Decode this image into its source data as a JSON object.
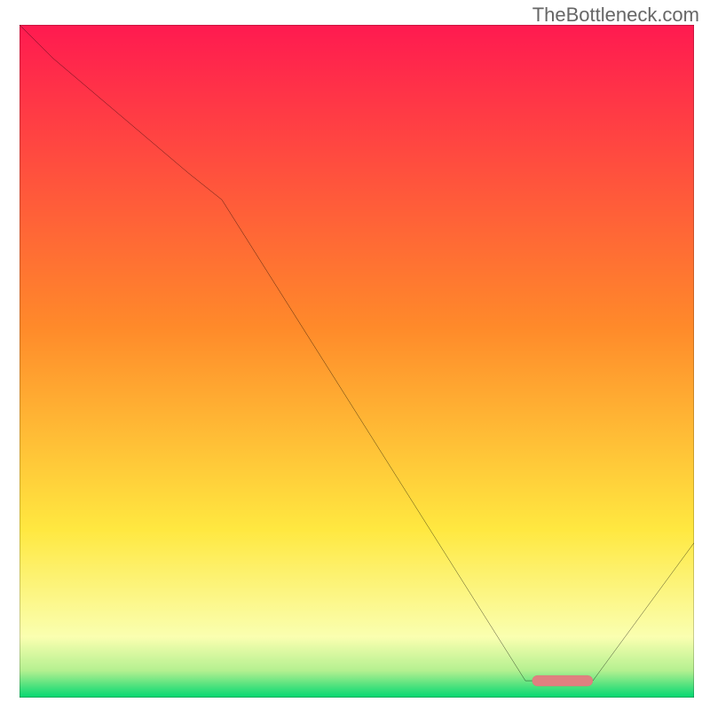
{
  "watermark": "TheBottleneck.com",
  "colors": {
    "line": "#000000",
    "marker_fill": "#e08080",
    "marker_stroke": "#c7605e",
    "border": "#000000",
    "grad_top": "#ff1a50",
    "grad_mid_upper": "#ff8a2a",
    "grad_mid_lower": "#ffe840",
    "grad_pale": "#faffb0",
    "grad_green": "#00d770"
  },
  "chart_data": {
    "type": "line",
    "title": "",
    "xlabel": "",
    "ylabel": "",
    "xlim": [
      0,
      100
    ],
    "ylim": [
      0,
      100
    ],
    "x": [
      0,
      5,
      25,
      30,
      75,
      78,
      85,
      100
    ],
    "values": [
      100,
      95,
      78,
      74,
      2.5,
      2.5,
      2.5,
      23
    ],
    "annotations": [
      {
        "type": "marker-bar",
        "x_start": 76,
        "x_end": 85,
        "y": 2.5
      }
    ],
    "background_bands": [
      {
        "y_from": 100,
        "y_to": 40,
        "desc": "red-to-orange"
      },
      {
        "y_from": 40,
        "y_to": 10,
        "desc": "orange-to-yellow"
      },
      {
        "y_from": 10,
        "y_to": 3,
        "desc": "pale-yellow"
      },
      {
        "y_from": 3,
        "y_to": 0,
        "desc": "green"
      }
    ]
  }
}
